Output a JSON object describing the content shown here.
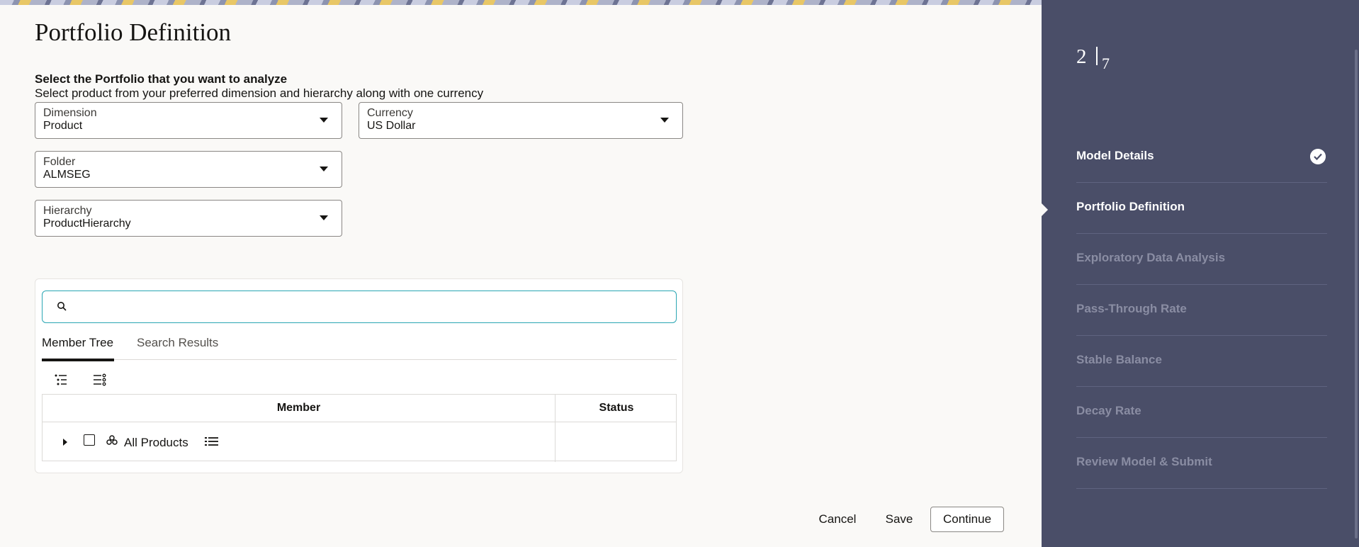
{
  "page": {
    "title": "Portfolio Definition",
    "heading": "Select the Portfolio that you want to analyze",
    "subheading": "Select product from your preferred dimension and hierarchy along with one currency"
  },
  "fields": {
    "dimension": {
      "label": "Dimension",
      "value": "Product"
    },
    "currency": {
      "label": "Currency",
      "value": "US Dollar"
    },
    "folder": {
      "label": "Folder",
      "value": "ALMSEG"
    },
    "hierarchy": {
      "label": "Hierarchy",
      "value": "ProductHierarchy"
    }
  },
  "tree": {
    "search_placeholder": "",
    "tabs": [
      {
        "label": "Member Tree",
        "active": true
      },
      {
        "label": "Search Results",
        "active": false
      }
    ],
    "columns": [
      "Member",
      "Status"
    ],
    "rows": [
      {
        "member": "All Products",
        "status": ""
      }
    ]
  },
  "footer": {
    "cancel": "Cancel",
    "save": "Save",
    "continue": "Continue"
  },
  "sidebar": {
    "current_step": "2",
    "total_steps": "7",
    "steps": [
      {
        "label": "Model Details",
        "state": "done"
      },
      {
        "label": "Portfolio Definition",
        "state": "current"
      },
      {
        "label": "Exploratory Data Analysis",
        "state": "todo"
      },
      {
        "label": "Pass-Through Rate",
        "state": "todo"
      },
      {
        "label": "Stable Balance",
        "state": "todo"
      },
      {
        "label": "Decay Rate",
        "state": "todo"
      },
      {
        "label": "Review Model & Submit",
        "state": "todo"
      }
    ]
  },
  "colors": {
    "sidebar_bg": "#4a4e68",
    "search_focus": "#2aa6b3",
    "page_bg": "#faf9f7"
  }
}
